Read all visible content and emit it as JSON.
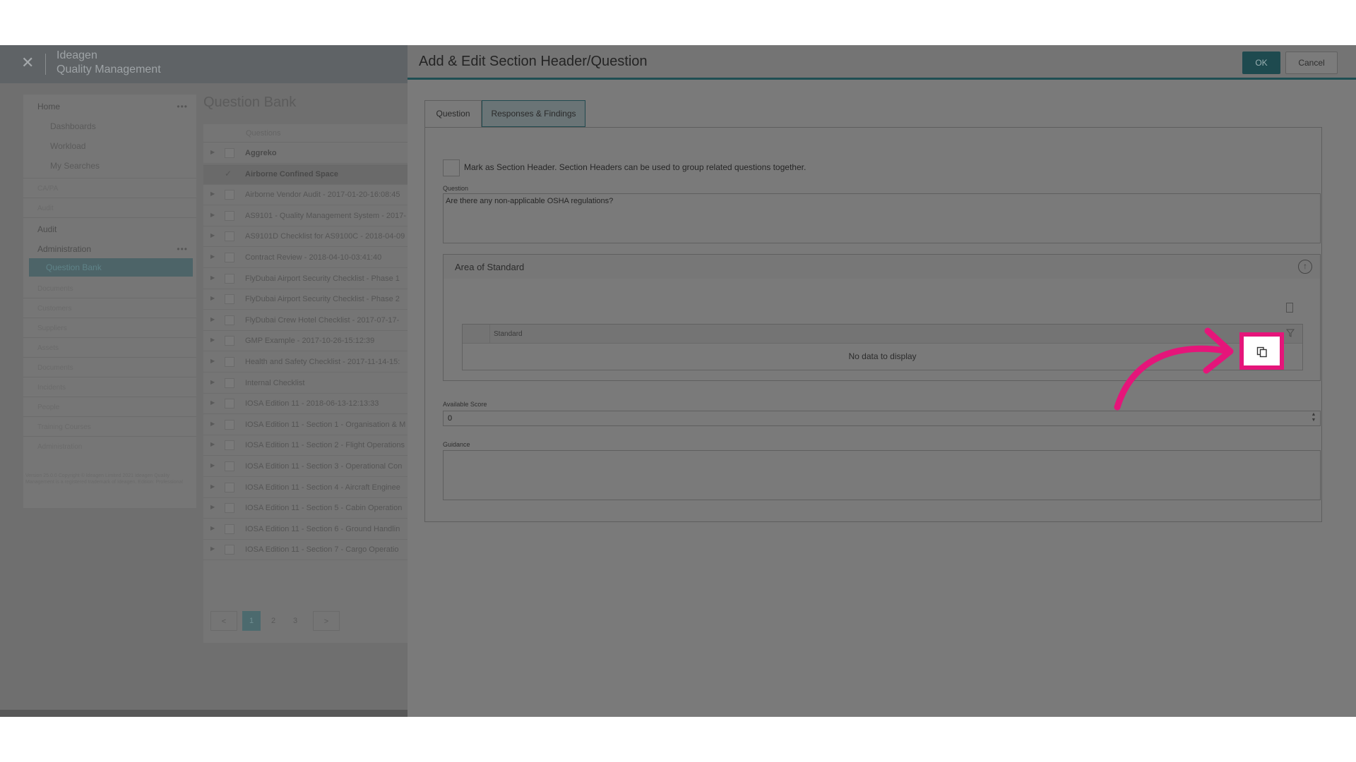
{
  "app": {
    "brand": "Ideagen",
    "product": "Quality Management"
  },
  "sidebar": {
    "items": [
      {
        "label": "Home",
        "menu": "•••"
      },
      {
        "label": "Dashboards"
      },
      {
        "label": "Workload"
      },
      {
        "label": "My Searches"
      },
      {
        "label": "CA/PA"
      },
      {
        "label": "Audit"
      },
      {
        "label": "Audit"
      },
      {
        "label": "Administration",
        "menu": "•••"
      },
      {
        "label": "Question Bank"
      },
      {
        "label": "Documents"
      },
      {
        "label": "Customers"
      },
      {
        "label": "Suppliers"
      },
      {
        "label": "Assets"
      },
      {
        "label": "Documents"
      },
      {
        "label": "Incidents"
      },
      {
        "label": "People"
      },
      {
        "label": "Training Courses"
      },
      {
        "label": "Administration"
      }
    ],
    "version_text": "Version 25.0.0 Copyright © Ideagen Limited 2021 Ideagen Quality Management is a registered trademark of Ideagen. Edition: Professional"
  },
  "question_bank": {
    "title": "Question Bank",
    "column_header": "Questions",
    "rows": [
      {
        "label": "Aggreko"
      },
      {
        "label": "Airborne Confined Space",
        "check": "✓"
      },
      {
        "label": "Airborne Vendor Audit - 2017-01-20-16:08:45"
      },
      {
        "label": "AS9101 - Quality Management System - 2017-"
      },
      {
        "label": "AS9101D Checklist for AS9100C - 2018-04-09"
      },
      {
        "label": "Contract Review - 2018-04-10-03:41:40"
      },
      {
        "label": "FlyDubai Airport Security Checklist - Phase 1"
      },
      {
        "label": "FlyDubai Airport Security Checklist - Phase 2"
      },
      {
        "label": "FlyDubai Crew Hotel Checklist - 2017-07-17-"
      },
      {
        "label": "GMP Example - 2017-10-26-15:12:39"
      },
      {
        "label": "Health and Safety Checklist - 2017-11-14-15:"
      },
      {
        "label": "Internal Checklist"
      },
      {
        "label": "IOSA Edition 11 - 2018-06-13-12:13:33"
      },
      {
        "label": "IOSA Edition 11 - Section 1 - Organisation & M"
      },
      {
        "label": "IOSA Edition 11 - Section 2 - Flight Operations"
      },
      {
        "label": "IOSA Edition 11 - Section 3 - Operational Con"
      },
      {
        "label": "IOSA Edition 11 - Section 4 - Aircraft Enginee"
      },
      {
        "label": "IOSA Edition 11 - Section 5 - Cabin Operation"
      },
      {
        "label": "IOSA Edition 11 - Section 6 - Ground Handlin"
      },
      {
        "label": "IOSA Edition 11 - Section 7 - Cargo Operatio"
      }
    ],
    "pagination": {
      "prev": "<",
      "pages": [
        "1",
        "2",
        "3"
      ],
      "next": ">"
    }
  },
  "dialog": {
    "title": "Add & Edit Section Header/Question",
    "ok_label": "OK",
    "cancel_label": "Cancel",
    "tabs": [
      {
        "label": "Question"
      },
      {
        "label": "Responses & Findings"
      }
    ],
    "section_header_text": "Mark as Section Header. Section Headers can be used to group related questions together.",
    "question_label": "Question",
    "question_value": "Are there any non-applicable OSHA regulations?",
    "area_of_standard": {
      "title": "Area of Standard",
      "column": "Standard",
      "empty_text": "No data to display"
    },
    "available_score_label": "Available Score",
    "available_score_value": "0",
    "guidance_label": "Guidance",
    "guidance_value": ""
  },
  "highlight": {
    "color": "#e5157a",
    "target_icon": "copy-icon"
  },
  "colors": {
    "accent": "#1e4a4f",
    "highlight": "#e5157a"
  }
}
